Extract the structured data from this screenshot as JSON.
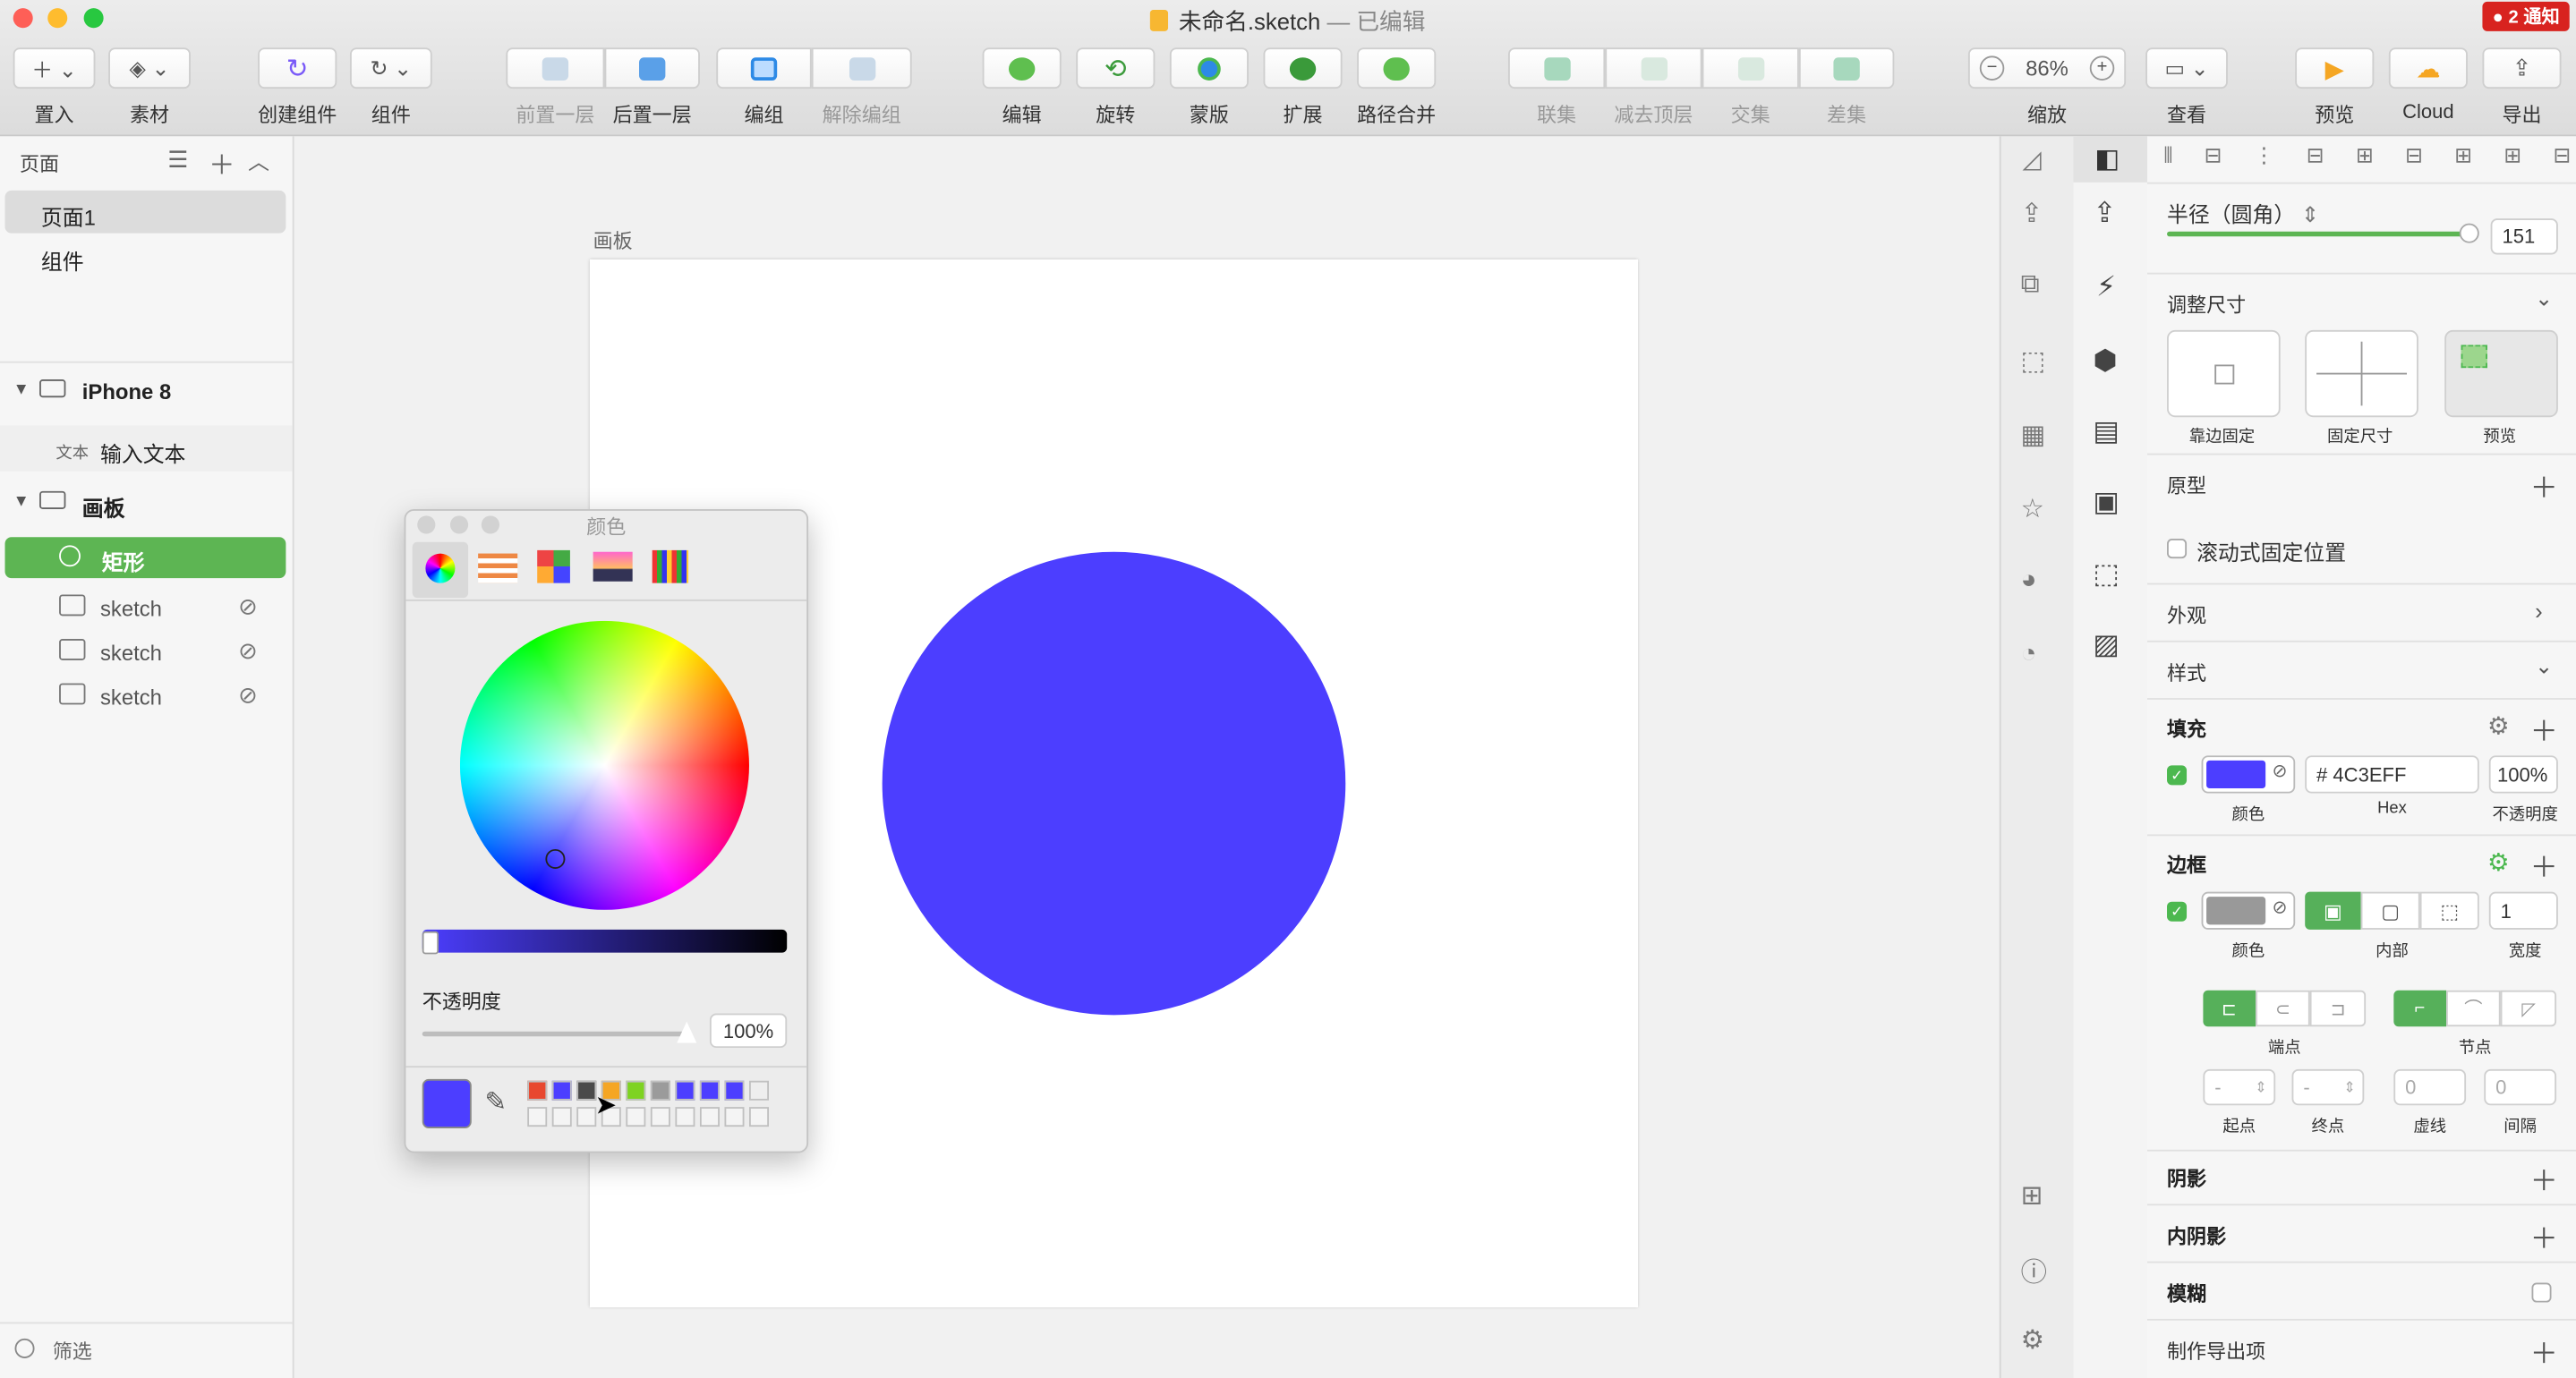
{
  "window": {
    "title": "未命名.sketch",
    "status": "— 已编辑",
    "notification": "● 2 通知"
  },
  "toolbar": {
    "insert": "置入",
    "assets": "素材",
    "create_symbol": "创建组件",
    "symbols": "组件",
    "backward": "前置一层",
    "forward": "后置一层",
    "group": "编组",
    "ungroup": "解除编组",
    "edit": "编辑",
    "rotate": "旋转",
    "mask": "蒙版",
    "scale": "扩展",
    "flatten": "路径合并",
    "union": "联集",
    "subtract": "减去顶层",
    "intersect": "交集",
    "difference": "差集",
    "zoom_label": "缩放",
    "zoom_value": "86%",
    "view": "查看",
    "preview": "预览",
    "cloud": "Cloud",
    "export": "导出"
  },
  "pages": {
    "header": "页面",
    "items": [
      "页面1",
      "组件"
    ]
  },
  "layers": {
    "artboard1": "iPhone 8",
    "text_tag": "文本",
    "text_layer": "输入文本",
    "artboard2": "画板",
    "selected": "矩形",
    "images": [
      "sketch",
      "sketch",
      "sketch"
    ],
    "filter": "筛选"
  },
  "canvas": {
    "artboard_label": "画板",
    "shape_color": "#4C3EFF"
  },
  "color_picker": {
    "title": "颜色",
    "opacity_label": "不透明度",
    "opacity_value": "100%",
    "swatches": [
      "#e8482f",
      "#4c3eff",
      "#4a4a4a",
      "#f5a623",
      "#7ed321",
      "#9b9b9b",
      "#4c3eff",
      "#4c3eff",
      "#4c3eff",
      "#eeeeee"
    ]
  },
  "inspector": {
    "radius_label": "半径（圆角）",
    "radius_value": "151",
    "resize_label": "调整尺寸",
    "pin_label": "靠边固定",
    "fixed_label": "固定尺寸",
    "preview_label": "预览",
    "prototype_label": "原型",
    "fix_scroll_label": "滚动式固定位置",
    "appearance_label": "外观",
    "style_label": "样式",
    "fill_label": "填充",
    "fill_hex": "# 4C3EFF",
    "fill_opacity": "100%",
    "color_label": "颜色",
    "hex_label": "Hex",
    "opacity_label": "不透明度",
    "border_label": "边框",
    "border_inside_label": "内部",
    "border_width": "1",
    "width_label": "宽度",
    "ends_label": "端点",
    "joins_label": "节点",
    "start_label": "起点",
    "end_label": "终点",
    "start_value": "-",
    "end_value": "-",
    "dash_value": "0",
    "gap_value": "0",
    "dash_label": "虚线",
    "gap_label": "间隔",
    "shadow_label": "阴影",
    "inner_shadow_label": "内阴影",
    "blur_label": "模糊",
    "export_label": "制作导出项"
  }
}
